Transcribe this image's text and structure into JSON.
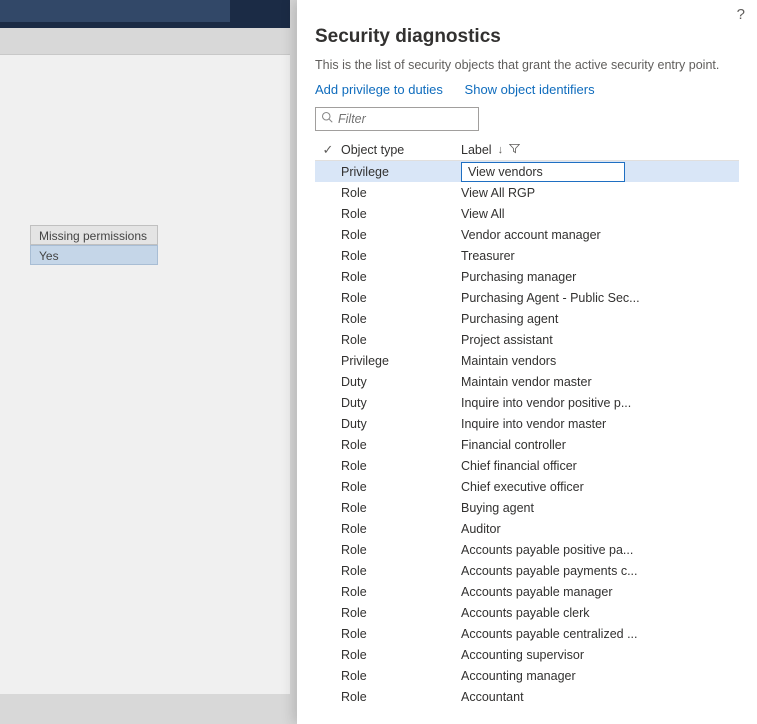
{
  "background": {
    "row1": "Missing permissions",
    "row2": "Yes"
  },
  "panel": {
    "title": "Security diagnostics",
    "description": "This is the list of security objects that grant the active security entry point.",
    "link_add_privilege": "Add privilege to duties",
    "link_show_identifiers": "Show object identifiers",
    "filter_placeholder": "Filter",
    "help_tooltip": "?"
  },
  "grid": {
    "header_object_type": "Object type",
    "header_label": "Label",
    "rows": [
      {
        "type": "Privilege",
        "label": "View vendors",
        "selected": true
      },
      {
        "type": "Role",
        "label": "View All RGP"
      },
      {
        "type": "Role",
        "label": "View All"
      },
      {
        "type": "Role",
        "label": "Vendor account manager"
      },
      {
        "type": "Role",
        "label": "Treasurer"
      },
      {
        "type": "Role",
        "label": "Purchasing manager"
      },
      {
        "type": "Role",
        "label": "Purchasing Agent - Public Sec..."
      },
      {
        "type": "Role",
        "label": "Purchasing agent"
      },
      {
        "type": "Role",
        "label": "Project assistant"
      },
      {
        "type": "Privilege",
        "label": "Maintain vendors"
      },
      {
        "type": "Duty",
        "label": "Maintain vendor master"
      },
      {
        "type": "Duty",
        "label": "Inquire into vendor positive p..."
      },
      {
        "type": "Duty",
        "label": "Inquire into vendor master"
      },
      {
        "type": "Role",
        "label": "Financial controller"
      },
      {
        "type": "Role",
        "label": "Chief financial officer"
      },
      {
        "type": "Role",
        "label": "Chief executive officer"
      },
      {
        "type": "Role",
        "label": "Buying agent"
      },
      {
        "type": "Role",
        "label": "Auditor"
      },
      {
        "type": "Role",
        "label": "Accounts payable positive pa..."
      },
      {
        "type": "Role",
        "label": "Accounts payable payments c..."
      },
      {
        "type": "Role",
        "label": "Accounts payable manager"
      },
      {
        "type": "Role",
        "label": "Accounts payable clerk"
      },
      {
        "type": "Role",
        "label": "Accounts payable centralized ..."
      },
      {
        "type": "Role",
        "label": "Accounting supervisor"
      },
      {
        "type": "Role",
        "label": "Accounting manager"
      },
      {
        "type": "Role",
        "label": "Accountant"
      }
    ]
  }
}
